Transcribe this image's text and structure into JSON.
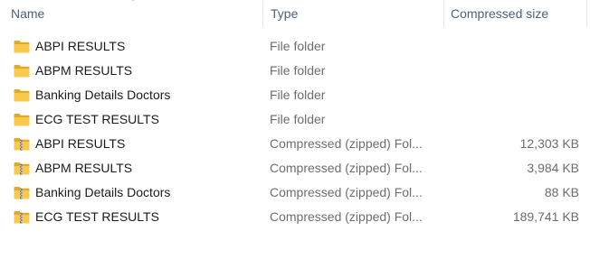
{
  "columns": {
    "name": "Name",
    "type": "Type",
    "compressed_size": "Compressed size"
  },
  "rows": [
    {
      "name": "ABPI RESULTS",
      "type": "File folder",
      "size": "",
      "icon": "folder-icon"
    },
    {
      "name": "ABPM RESULTS",
      "type": "File folder",
      "size": "",
      "icon": "folder-icon"
    },
    {
      "name": "Banking Details Doctors",
      "type": "File folder",
      "size": "",
      "icon": "folder-icon"
    },
    {
      "name": "ECG TEST RESULTS",
      "type": "File folder",
      "size": "",
      "icon": "folder-icon"
    },
    {
      "name": "ABPI RESULTS",
      "type": "Compressed (zipped) Fol...",
      "size": "12,303 KB",
      "icon": "zip-folder-icon"
    },
    {
      "name": "ABPM RESULTS",
      "type": "Compressed (zipped) Fol...",
      "size": "3,984 KB",
      "icon": "zip-folder-icon"
    },
    {
      "name": "Banking Details Doctors",
      "type": "Compressed (zipped) Fol...",
      "size": "88 KB",
      "icon": "zip-folder-icon"
    },
    {
      "name": "ECG TEST RESULTS",
      "type": "Compressed (zipped) Fol...",
      "size": "189,741 KB",
      "icon": "zip-folder-icon"
    }
  ],
  "colors": {
    "header_text": "#4c607a",
    "folder_yellow": "#f8c94a",
    "folder_dark": "#e1a92a",
    "secondary_text": "#6d6d6d"
  }
}
